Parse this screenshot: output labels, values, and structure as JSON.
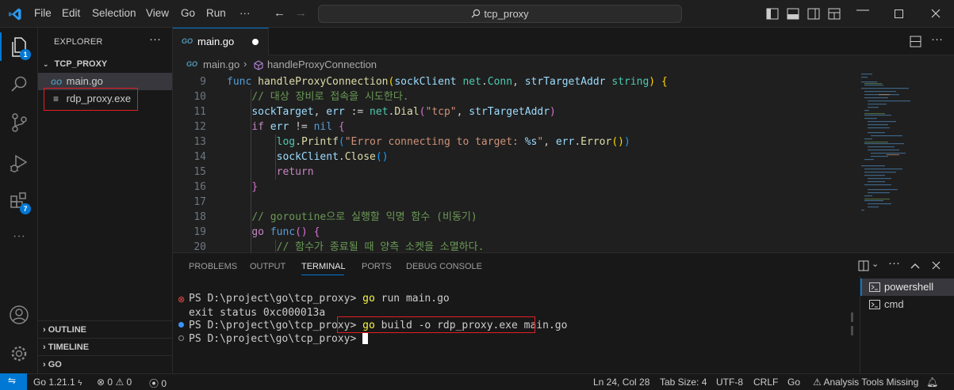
{
  "titlebar": {
    "menu": [
      "File",
      "Edit",
      "Selection",
      "View",
      "Go",
      "Run",
      "···"
    ],
    "search": "tcp_proxy"
  },
  "activity": {
    "explorer_badge": "1",
    "extensions_badge": "7"
  },
  "sidebar": {
    "title": "EXPLORER",
    "more": "···",
    "folder": "TCP_PROXY",
    "files": [
      {
        "name": "main.go",
        "icon": "go-file-icon"
      },
      {
        "name": "rdp_proxy.exe",
        "icon": "file-icon"
      }
    ],
    "sections": [
      "OUTLINE",
      "TIMELINE",
      "GO"
    ]
  },
  "editor": {
    "tab": "main.go",
    "breadcrumb_file": "main.go",
    "breadcrumb_symbol": "handleProxyConnection",
    "line_numbers": [
      "9",
      "10",
      "11",
      "12",
      "13",
      "14",
      "15",
      "16",
      "17",
      "18",
      "19",
      "20"
    ]
  },
  "panel": {
    "tabs": [
      "PROBLEMS",
      "OUTPUT",
      "TERMINAL",
      "PORTS",
      "DEBUG CONSOLE"
    ],
    "active_tab": "TERMINAL",
    "lines": [
      {
        "prompt": "PS D:\\project\\go\\tcp_proxy> ",
        "cmd": "go",
        "rest": " run main.go"
      },
      {
        "text": "exit status 0xc000013a"
      },
      {
        "prompt": "PS D:\\project\\go\\tcp_proxy> ",
        "cmd": "go",
        "rest": " build -o rdp_proxy.exe main.go"
      },
      {
        "prompt": "PS D:\\project\\go\\tcp_proxy> "
      }
    ],
    "terminals": [
      "powershell",
      "cmd"
    ]
  },
  "status": {
    "go_version": "Go 1.21.1",
    "errors": "0",
    "warnings": "0",
    "ports": "0",
    "position": "Ln 24, Col 28",
    "tab_size": "Tab Size: 4",
    "encoding": "UTF-8",
    "eol": "CRLF",
    "language": "Go",
    "analysis": "Analysis Tools Missing"
  },
  "colors": {
    "accent": "#0078d4",
    "highlight": "#e51e25"
  }
}
